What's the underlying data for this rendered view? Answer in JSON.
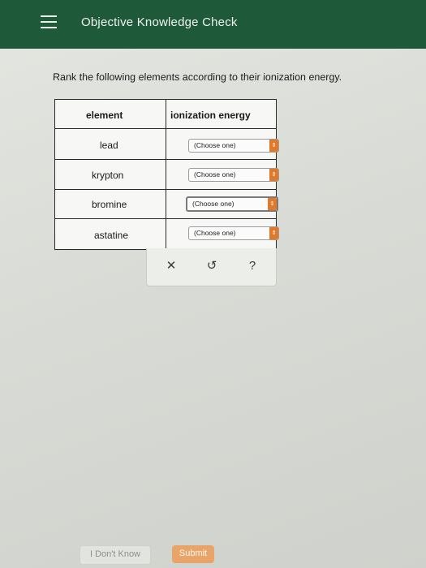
{
  "header": {
    "title": "Objective Knowledge Check"
  },
  "prompt": "Rank the following elements according to their ionization energy.",
  "table": {
    "col_element": "element",
    "col_energy": "ionization energy",
    "rows": [
      {
        "element": "lead",
        "selection": "(Choose one)"
      },
      {
        "element": "krypton",
        "selection": "(Choose one)"
      },
      {
        "element": "bromine",
        "selection": "(Choose one)"
      },
      {
        "element": "astatine",
        "selection": "(Choose one)"
      }
    ]
  },
  "actions": {
    "clear": "✕",
    "undo": "↺",
    "help": "?"
  },
  "footer": {
    "dont_know": "I Don't Know",
    "submit": "Submit"
  },
  "colors": {
    "header": "#1e5a3a",
    "select_arrow": "#e07a2a",
    "submit": "#e9a46a"
  },
  "icons": {
    "menu": "hamburger-menu-icon",
    "select": "up-down-arrows-icon"
  }
}
